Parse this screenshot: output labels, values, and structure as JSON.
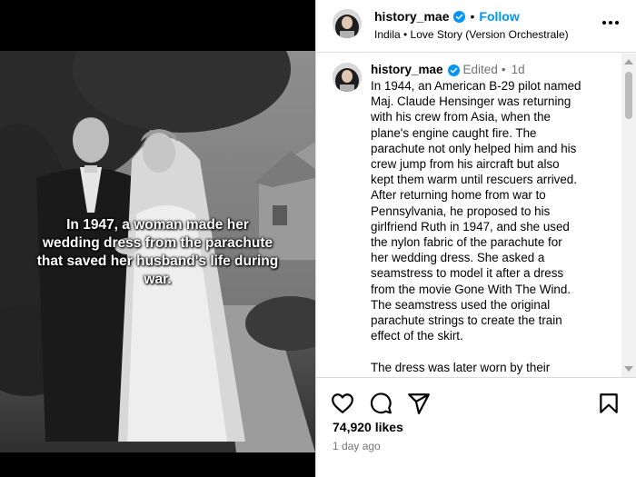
{
  "media": {
    "overlay_caption": "In 1947, a woman made her wedding dress from the parachute that saved her husband's life during war."
  },
  "header": {
    "username": "history_mae",
    "separator": "•",
    "follow_label": "Follow",
    "audio": "Indila • Love Story (Version Orchestrale)"
  },
  "caption": {
    "username": "history_mae",
    "edited": "Edited",
    "separator": "•",
    "time": "1d",
    "text": "In 1944, an American B-29 pilot named\nMaj. Claude Hensinger was returning\nwith his crew from Asia, when the\nplane's engine caught fire. The\nparachute not only helped him and his\ncrew jump from his aircraft but also\nkept them warm until rescuers arrived.\nAfter returning home from war to\nPennsylvania, he proposed to his\ngirlfriend Ruth in 1947, and she used\nthe nylon fabric of the parachute for\nher wedding dress. She asked a\nseamstress to model it after a dress\nfrom the movie Gone With The Wind.\nThe seamstress used the original\nparachute strings to create the train\neffect of the skirt.\n\nThe dress was later worn by their"
  },
  "engagement": {
    "likes": "74,920 likes",
    "posted": "1 day ago"
  },
  "colors": {
    "accent": "#0095f6",
    "verified": "#0095f6",
    "muted": "#737373",
    "border": "#dbdbdb"
  },
  "icons": {
    "like": "heart-icon",
    "comment": "comment-icon",
    "share": "send-icon",
    "save": "bookmark-icon",
    "more": "more-options-icon",
    "verified": "verified-badge-icon"
  }
}
